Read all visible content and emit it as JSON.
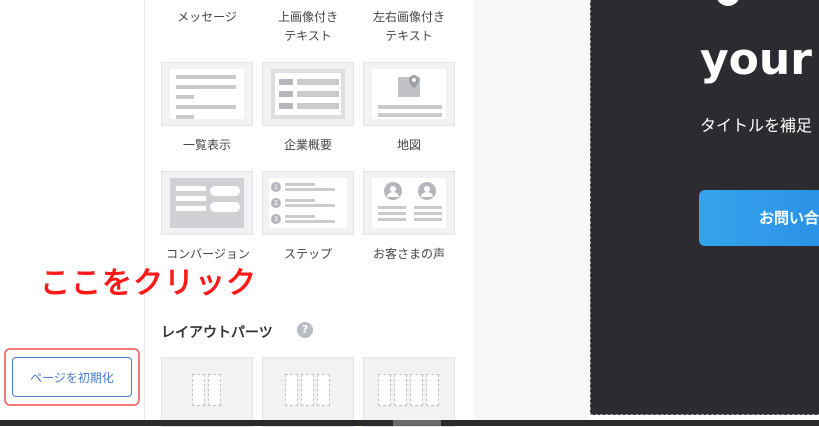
{
  "blocks": {
    "row1_labels": [
      "メッセージ",
      "上画像付き\nテキスト",
      "左右画像付き\nテキスト"
    ],
    "row2": [
      {
        "label": "一覧表示",
        "icon": "list-layout-icon"
      },
      {
        "label": "企業概要",
        "icon": "company-overview-icon"
      },
      {
        "label": "地図",
        "icon": "map-pin-icon"
      }
    ],
    "row3": [
      {
        "label": "コンバージョン",
        "icon": "conversion-form-icon"
      },
      {
        "label": "ステップ",
        "icon": "numbered-steps-icon"
      },
      {
        "label": "お客さまの声",
        "icon": "testimonial-avatars-icon"
      }
    ]
  },
  "layout_parts": {
    "title": "レイアウトパーツ",
    "help_icon": "question-icon"
  },
  "reset_button": {
    "label": "ページを初期化"
  },
  "annotation": {
    "text": "ここをクリック",
    "color": "#ff1a1a"
  },
  "preview": {
    "title_partial": "your",
    "subtitle_partial": "タイトルを補足",
    "cta_partial": "お問い合",
    "background": "#2c2c30"
  },
  "step_numbers": [
    "1",
    "2",
    "3"
  ]
}
